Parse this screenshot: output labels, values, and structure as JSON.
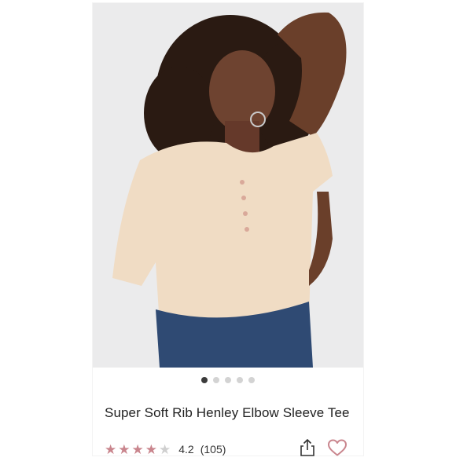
{
  "product": {
    "title": "Super Soft Rib Henley Elbow Sleeve Tee",
    "rating_value": "4.2",
    "rating_count": "(105)",
    "rating_fraction": 0.84,
    "stars_filled": 4,
    "stars_total": 5
  },
  "carousel": {
    "image_count": 5,
    "active_index": 0
  },
  "icons": {
    "star": "star-icon",
    "share": "share-icon",
    "wishlist": "heart-icon"
  },
  "colors": {
    "star_filled": "#c9858d",
    "star_empty": "#cfcfcf",
    "heart": "#c9858d",
    "dot_active": "#3b3b3b",
    "dot_inactive": "#d3d3d3",
    "shirt": "#f0dcc4",
    "jeans": "#2f4a73"
  }
}
